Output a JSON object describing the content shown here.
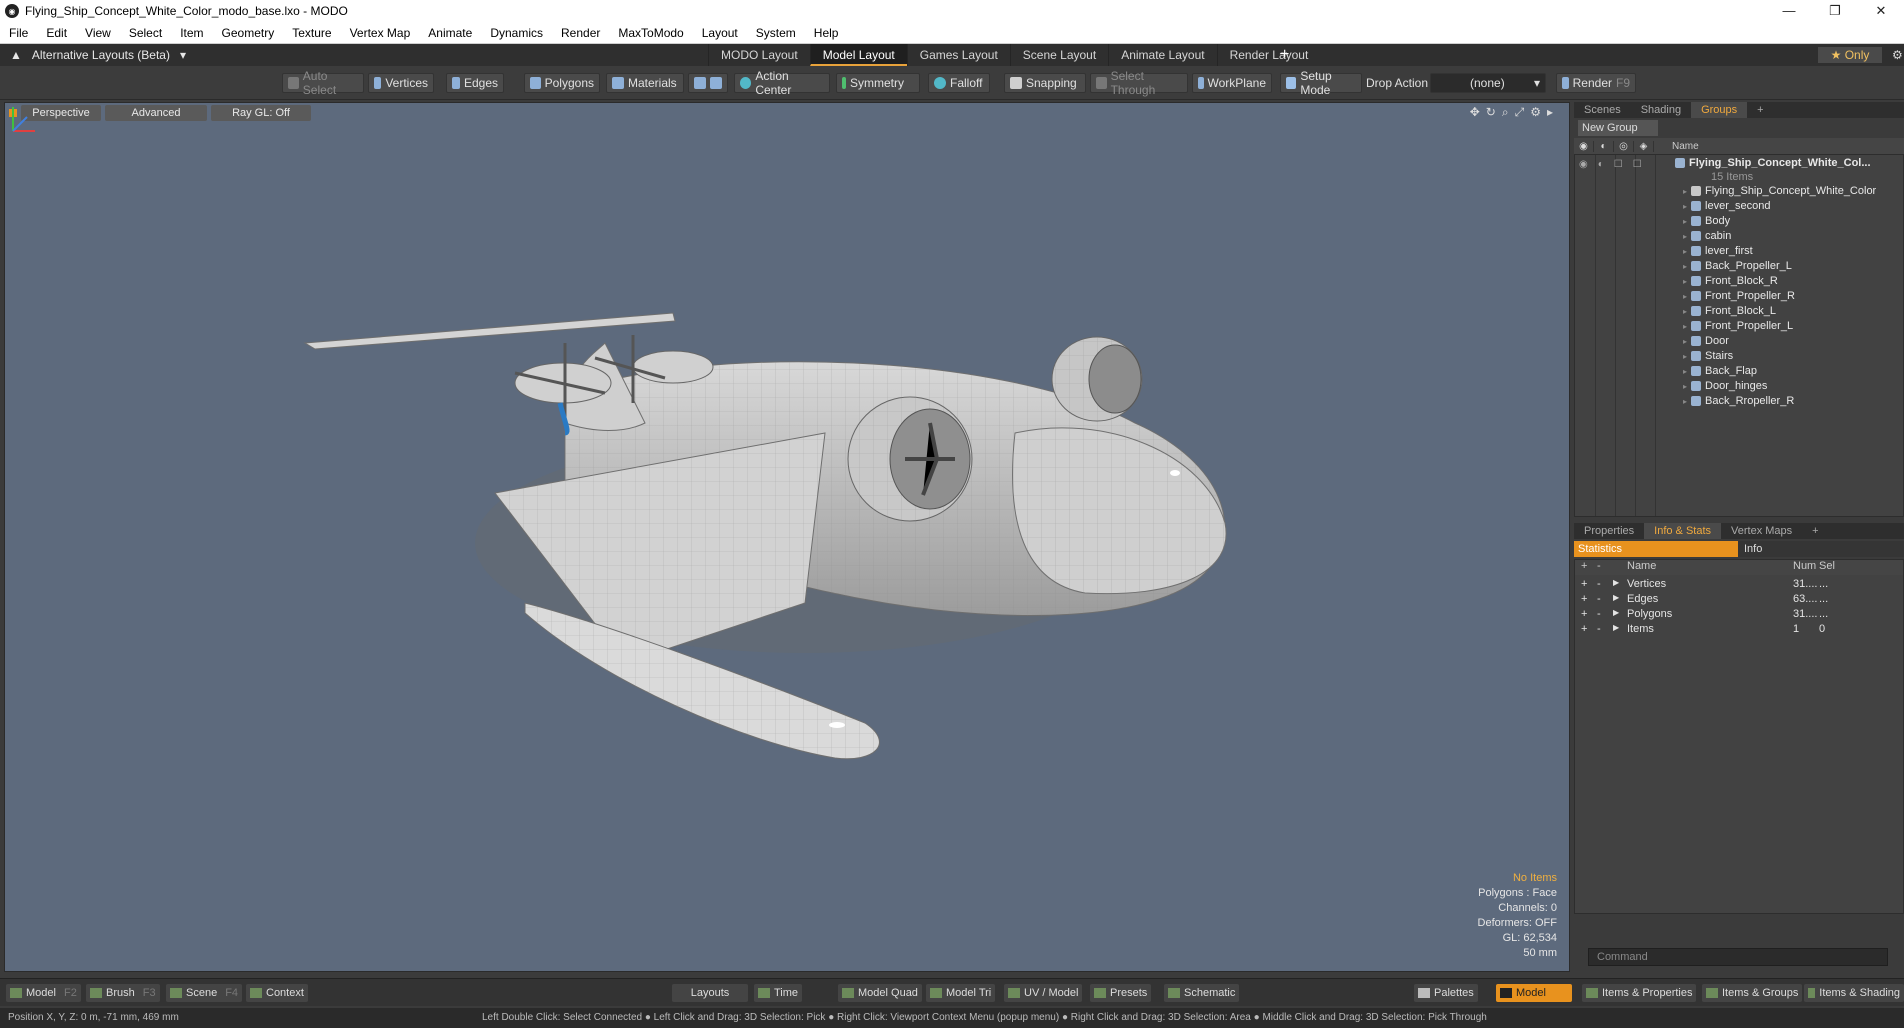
{
  "window": {
    "title": "Flying_Ship_Concept_White_Color_modo_base.lxo - MODO",
    "controls": [
      "—",
      "❐",
      "✕"
    ]
  },
  "menu": [
    "File",
    "Edit",
    "View",
    "Select",
    "Item",
    "Geometry",
    "Texture",
    "Vertex Map",
    "Animate",
    "Dynamics",
    "Render",
    "MaxToModo",
    "Layout",
    "System",
    "Help"
  ],
  "layoutbar": {
    "alt_layouts": "Alternative Layouts (Beta)",
    "tabs": [
      "MODO Layout",
      "Model Layout",
      "Games Layout",
      "Scene Layout",
      "Animate Layout",
      "Render Layout"
    ],
    "active_tab": "Model Layout",
    "only": "Only"
  },
  "toolbar": {
    "auto_select": "Auto Select",
    "vertices": "Vertices",
    "edges": "Edges",
    "polygons": "Polygons",
    "materials": "Materials",
    "action_center": "Action Center",
    "symmetry": "Symmetry",
    "falloff": "Falloff",
    "snapping": "Snapping",
    "select_through": "Select Through",
    "workplane": "WorkPlane",
    "setup_mode": "Setup Mode",
    "drop_action": "Drop Action",
    "drop_value": "(none)",
    "render": "Render",
    "render_key": "F9"
  },
  "viewport": {
    "view": "Perspective",
    "mode": "Advanced",
    "raygl": "Ray GL: Off",
    "info": {
      "no_items": "No Items",
      "polygons": "Polygons : Face",
      "channels": "Channels: 0",
      "deformers": "Deformers: OFF",
      "gl": "GL: 62,534",
      "scale": "50 mm"
    }
  },
  "groups_panel": {
    "tabs": [
      "Scenes",
      "Shading",
      "Groups"
    ],
    "active_tab": "Groups",
    "new_group": "New Group",
    "col_name": "Name",
    "root": {
      "name": "Flying_Ship_Concept_White_Col...",
      "count": "15 Items"
    },
    "items": [
      "Flying_Ship_Concept_White_Color",
      "lever_second",
      "Body",
      "cabin",
      "lever_first",
      "Back_Propeller_L",
      "Front_Block_R",
      "Front_Propeller_R",
      "Front_Block_L",
      "Front_Propeller_L",
      "Door",
      "Stairs",
      "Back_Flap",
      "Door_hinges",
      "Back_Rropeller_R"
    ]
  },
  "stats_panel": {
    "tabs": [
      "Properties",
      "Info & Stats",
      "Vertex Maps"
    ],
    "active_tab": "Info & Stats",
    "statistics": "Statistics",
    "info": "Info",
    "cols": {
      "name": "Name",
      "num": "Num",
      "sel": "Sel"
    },
    "rows": [
      {
        "name": "Vertices",
        "num": "31....",
        "sel": "..."
      },
      {
        "name": "Edges",
        "num": "63....",
        "sel": "..."
      },
      {
        "name": "Polygons",
        "num": "31....",
        "sel": "..."
      },
      {
        "name": "Items",
        "num": "1",
        "sel": "0"
      }
    ]
  },
  "command": {
    "placeholder": "Command"
  },
  "bottombar": {
    "model": "Model",
    "model_key": "F2",
    "brush": "Brush",
    "brush_key": "F3",
    "scene": "Scene",
    "scene_key": "F4",
    "context": "Context",
    "layouts": "Layouts",
    "time": "Time",
    "model_quad": "Model Quad",
    "model_tri": "Model Tri",
    "uv_model": "UV / Model",
    "presets": "Presets",
    "schematic": "Schematic",
    "palettes": "Palettes",
    "model_active": "Model",
    "items_props": "Items & Properties",
    "items_groups": "Items & Groups",
    "items_shading": "Items & Shading"
  },
  "status": {
    "position": "Position X, Y, Z:  0 m, -71 mm, 469 mm",
    "hint": "Left Double Click: Select Connected ● Left Click and Drag: 3D Selection: Pick ● Right Click: Viewport Context Menu (popup menu) ● Right Click and Drag: 3D Selection: Area ● Middle Click and Drag: 3D Selection: Pick Through"
  }
}
